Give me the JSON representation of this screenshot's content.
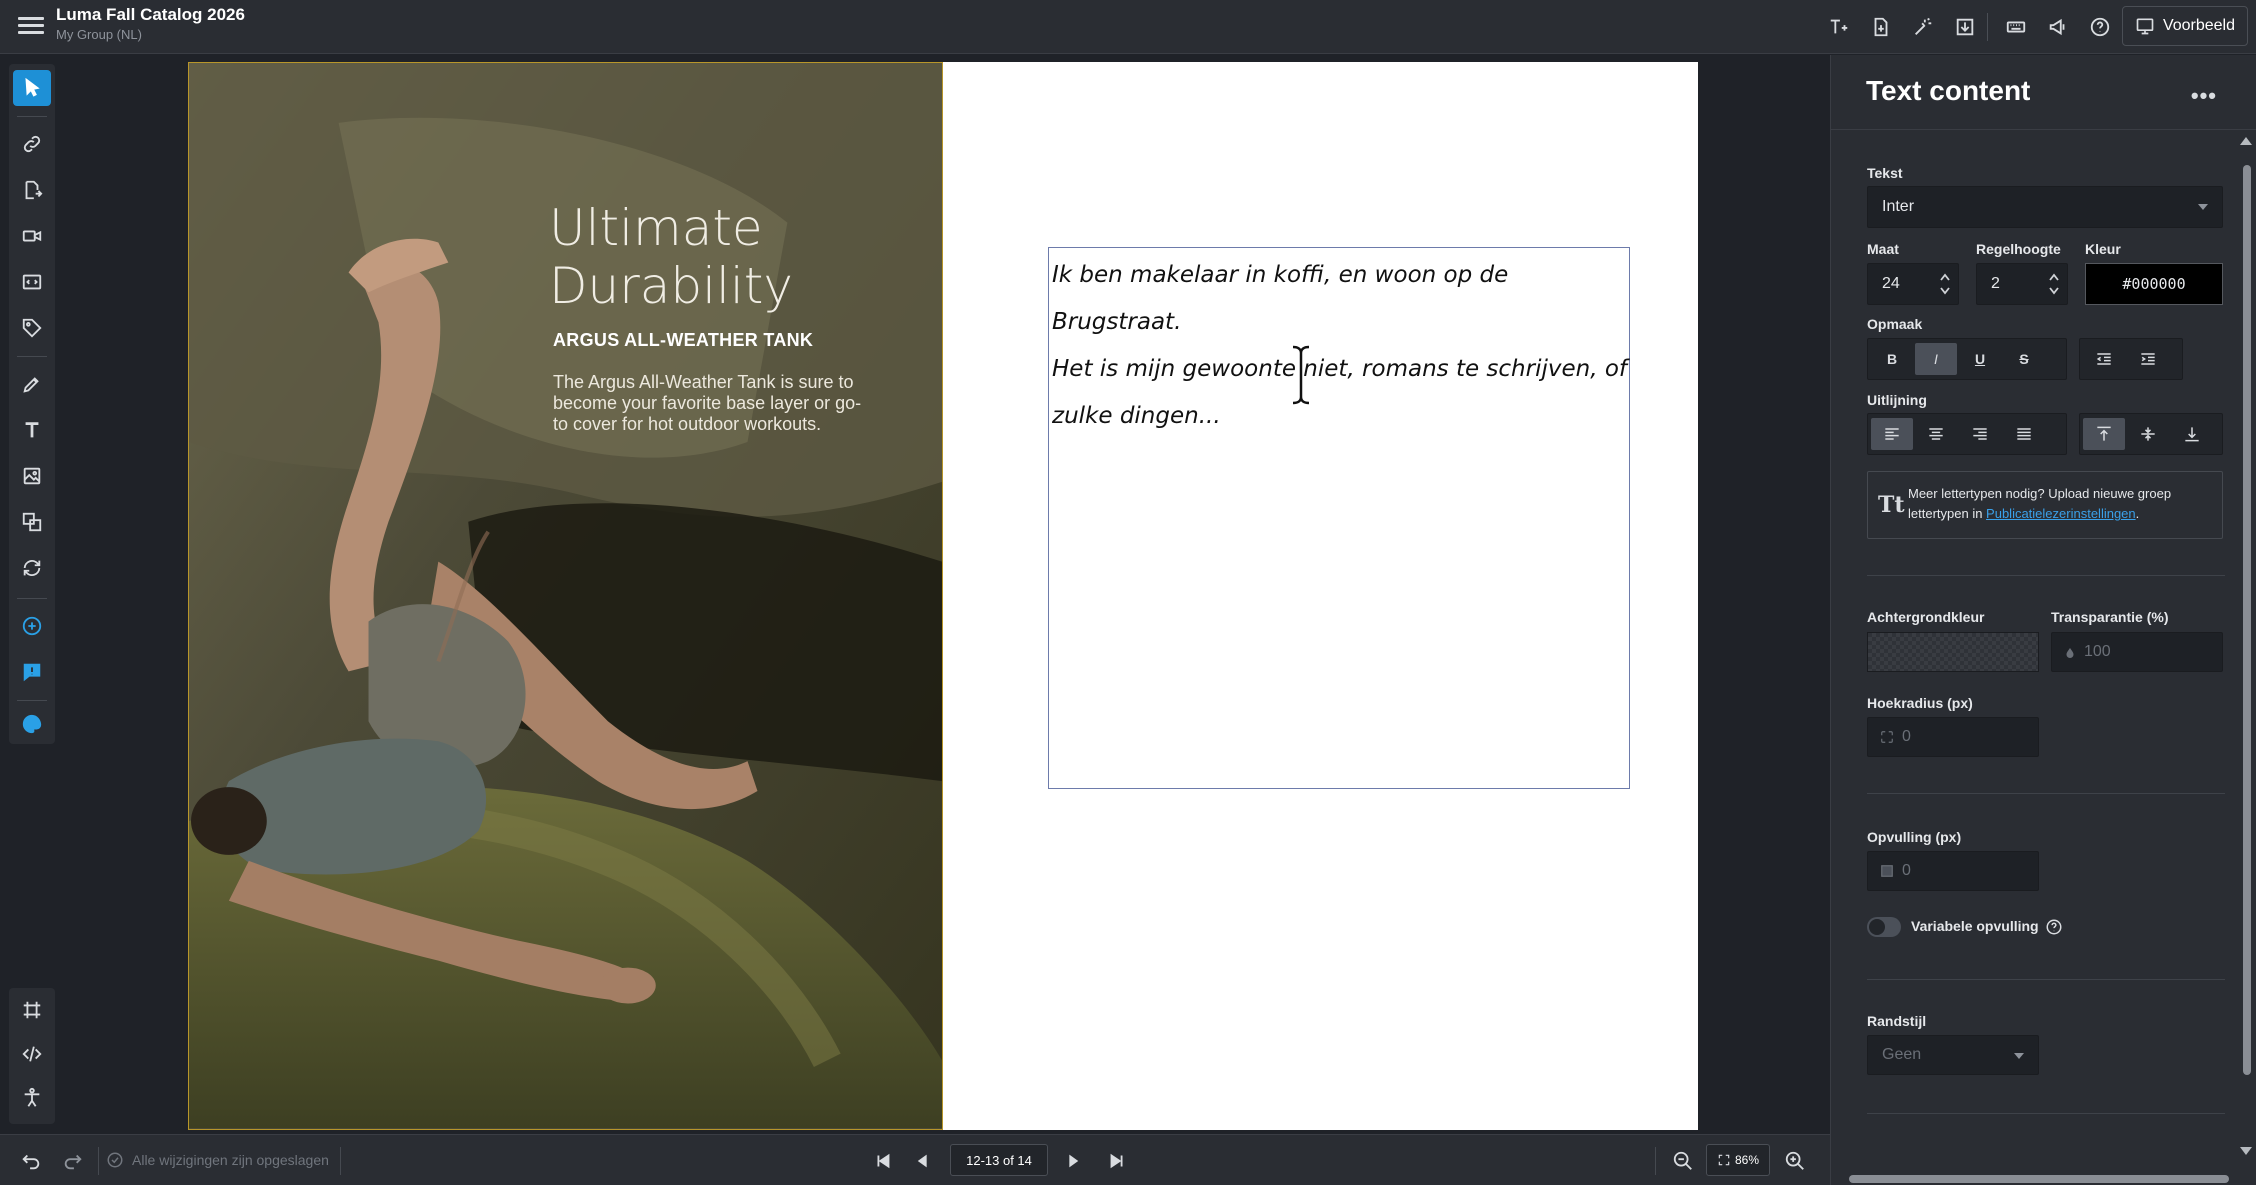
{
  "app": {
    "title": "Luma Fall Catalog 2026",
    "group": "My Group (NL)",
    "preview_label": "Voorbeeld"
  },
  "topbar": {
    "icons": [
      "text-add-icon",
      "document-export-icon",
      "magic-wand-icon",
      "download-icon",
      "keyboard-icon",
      "megaphone-icon",
      "help-icon"
    ]
  },
  "left_toolbar": {
    "tools": [
      "pointer-icon",
      "link-icon",
      "page-export-icon",
      "video-icon",
      "embed-code-icon",
      "tag-icon",
      "shape-tool-icon",
      "text-tool-icon",
      "image-icon",
      "layers-icon",
      "sync-icon",
      "add-circle-icon",
      "feedback-icon",
      "palette-icon"
    ],
    "bottom_tools": [
      "artboard-icon",
      "code-icon",
      "accessibility-icon"
    ]
  },
  "canvas": {
    "photo_title": "Ultimate\nDurability",
    "photo_subtitle": "ARGUS ALL-WEATHER TANK",
    "photo_body": "The Argus All-Weather Tank is sure to become your favorite base layer or go-to cover for hot outdoor workouts.",
    "frame_text_line1": "Ik ben makelaar in koffi, en woon op de Brugstraat.",
    "frame_text_line2": "Het is mijn gewoonte niet, romans te schrijven, of",
    "frame_text_line3": "zulke dingen..."
  },
  "bottombar": {
    "status": "Alle wijzigingen zijn opgeslagen",
    "page_indicator": "12-13 of 14",
    "zoom": "86%"
  },
  "panel": {
    "title": "Text content",
    "more": "•••",
    "tekst_label": "Tekst",
    "font": "Inter",
    "maat_label": "Maat",
    "maat_value": "24",
    "regelhoogte_label": "Regelhoogte",
    "regelhoogte_value": "2",
    "kleur_label": "Kleur",
    "kleur_value": "#000000",
    "opmaak_label": "Opmaak",
    "bold": "B",
    "italic": "I",
    "underline": "U",
    "strike": "S",
    "uitlijning_label": "Uitlijning",
    "info_text": "Meer lettertypen nodig? Upload nieuwe groep lettertypen in ",
    "info_link": "Publicatielezerinstellingen",
    "info_end": ".",
    "achtergrond_label": "Achtergrondkleur",
    "transparantie_label": "Transparantie (%)",
    "transparantie_value": "100",
    "hoekradius_label": "Hoekradius (px)",
    "hoekradius_value": "0",
    "opvulling_label": "Opvulling (px)",
    "opvulling_value": "0",
    "variabele_label": "Variabele opvulling",
    "randstijl_label": "Randstijl",
    "randstijl_value": "Geen"
  },
  "colors": {
    "accent": "#1e90d6",
    "panel_bg": "#2a2d33",
    "app_bg": "#1f2228",
    "link": "#3aa0e8"
  }
}
